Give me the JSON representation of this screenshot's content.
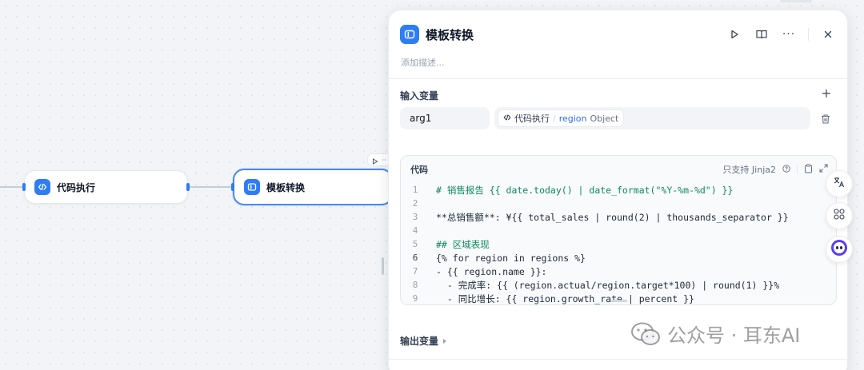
{
  "canvas": {
    "nodes": [
      {
        "title": "代码执行",
        "icon": "code-icon"
      },
      {
        "title": "模板转换",
        "icon": "template-icon"
      }
    ]
  },
  "panel": {
    "title": "模板转换",
    "description_placeholder": "添加描述...",
    "input_section": {
      "title": "输入变量",
      "variables": [
        {
          "name": "arg1",
          "source_node": "代码执行",
          "field": "region",
          "type": "Object"
        }
      ]
    },
    "code": {
      "label": "代码",
      "hint": "只支持 Jinja2",
      "lines": [
        {
          "num": "1",
          "text": "# 销售报告 {{ date.today() | date_format(\"%Y-%m-%d\") }}"
        },
        {
          "num": "2",
          "text": ""
        },
        {
          "num": "3",
          "text": "**总销售额**: ¥{{ total_sales | round(2) | thousands_separator }}"
        },
        {
          "num": "4",
          "text": ""
        },
        {
          "num": "5",
          "text": "## 区域表现"
        },
        {
          "num": "6",
          "text": "{% for region in regions %}"
        },
        {
          "num": "7",
          "text": "- {{ region.name }}:"
        },
        {
          "num": "8",
          "text": "  - 完成率: {{ (region.actual/region.target*100) | round(1) }}%"
        },
        {
          "num": "9",
          "text": "  - 同比增长: {{ region.growth_rate | percent }}"
        }
      ]
    },
    "output_section": {
      "title": "输出变量"
    }
  },
  "watermark": {
    "text": "公众号 · 耳东AI"
  },
  "colors": {
    "accent": "#2e7cf6",
    "selected_border": "#4e86f7",
    "comment": "#0b8a5c",
    "keyword": "#2e5bd6"
  }
}
